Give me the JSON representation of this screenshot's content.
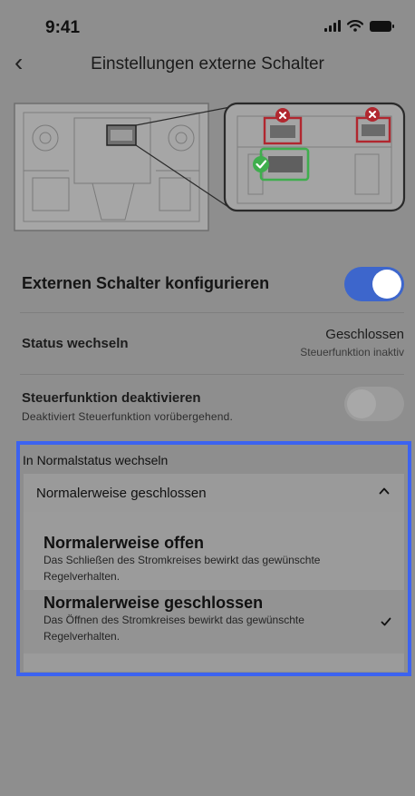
{
  "status_bar": {
    "time": "9:41"
  },
  "nav": {
    "back_icon": "chevron-left-icon",
    "back_glyph": "‹",
    "title": "Einstellungen externe Schalter"
  },
  "hero": {
    "icons": [
      "device-diagram",
      "error-x-icon",
      "error-x-icon",
      "success-check-icon"
    ],
    "colors": {
      "error": "#b1272f",
      "success": "#3fae4d"
    }
  },
  "config": {
    "label": "Externen Schalter konfigurieren",
    "toggle_on": true
  },
  "status_switch": {
    "label": "Status wechseln",
    "value": "Geschlossen",
    "detail": "Steuerfunktion inaktiv"
  },
  "deactivate": {
    "label": "Steuerfunktion deaktivieren",
    "description": "Deaktiviert Steuerfunktion vorübergehend.",
    "toggle_on": false
  },
  "normal_status": {
    "label": "In Normalstatus wechseln",
    "selected": "Normalerweise geschlossen",
    "options": [
      {
        "title": "Normalerweise offen",
        "description": "Das Schließen des Stromkreises bewirkt das gewünschte Regelverhalten.",
        "selected": false
      },
      {
        "title": "Normalerweise geschlossen",
        "description": "Das Öffnen des Stromkreises bewirkt das gewünschte Regelverhalten.",
        "selected": true
      }
    ]
  },
  "colors": {
    "accent": "#3d66cc",
    "highlight_border": "#3c63f0"
  }
}
